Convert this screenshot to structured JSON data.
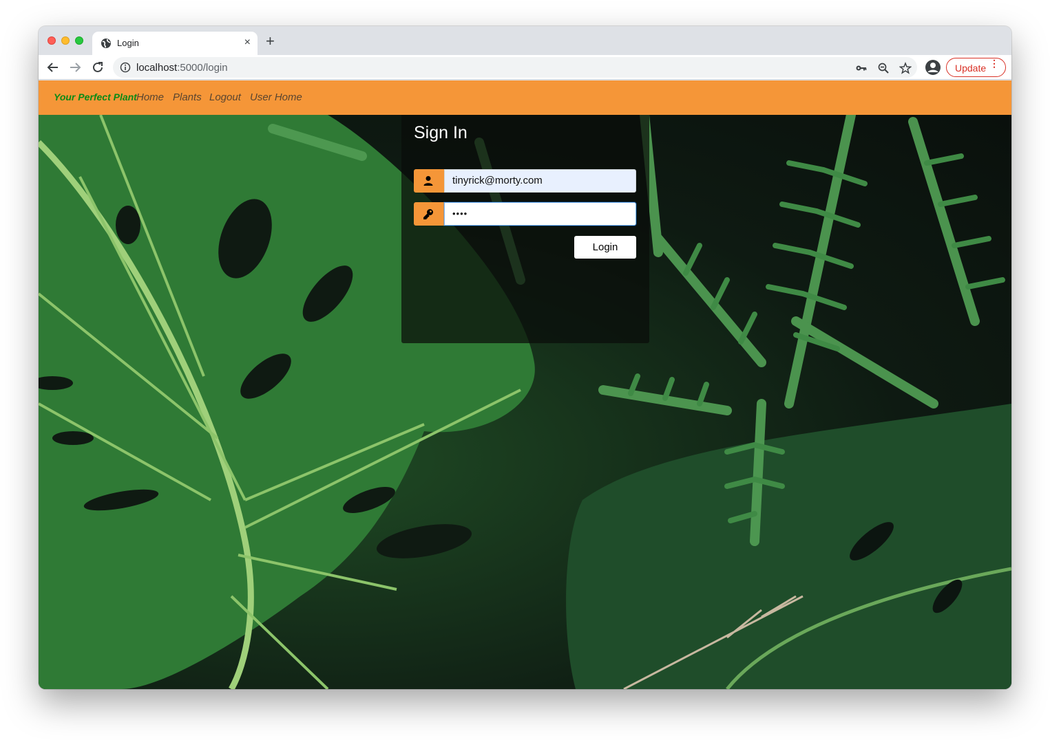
{
  "browser": {
    "tab_title": "Login",
    "tab_close": "×",
    "new_tab": "+",
    "url_host": "localhost",
    "url_path": ":5000/login",
    "update_label": "Update",
    "menu_dots": "⋮",
    "icons": [
      "back-icon",
      "forward-icon",
      "reload-icon",
      "info-icon",
      "key-icon",
      "zoom-out-icon",
      "star-icon",
      "profile-icon",
      "globe-icon"
    ]
  },
  "navbar": {
    "brand": "Your Perfect Plant",
    "links": [
      "Home",
      "Plants",
      "Logout",
      "User Home"
    ],
    "brand_color": "#0b8a16",
    "bg_color": "#f59638"
  },
  "login": {
    "title": "Sign In",
    "email_value": "tinyrick@morty.com",
    "password_value": "••••",
    "button_label": "Login",
    "icons": [
      "user-icon",
      "key-icon"
    ]
  }
}
